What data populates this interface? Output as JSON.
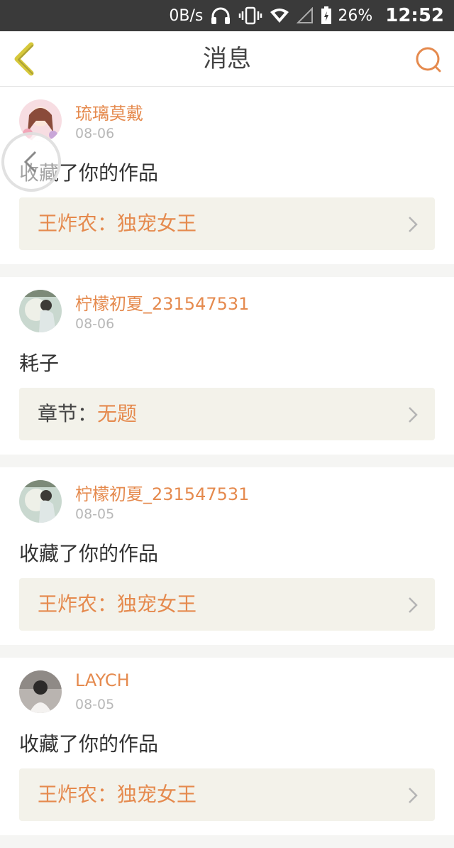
{
  "status_bar": {
    "speed": "0B/s",
    "battery_pct": "26%",
    "time": "12:52",
    "icons": [
      "headphones-icon",
      "vibrate-icon",
      "wifi-icon",
      "signal-icon",
      "battery-icon"
    ]
  },
  "header": {
    "title": "消息",
    "back_icon": "chevron-left-icon",
    "search_icon": "search-icon",
    "accent": "#e58a4e",
    "back_color": "#d6c83a"
  },
  "messages": [
    {
      "username": "琉璃莫戴",
      "date": "08-06",
      "text": "收藏了你的作品",
      "ref_prefix": "",
      "ref_title": "王炸农：独宠女王"
    },
    {
      "username": "柠檬初夏_231547531",
      "date": "08-06",
      "text": "耗子",
      "ref_prefix": "章节：",
      "ref_title": "无题"
    },
    {
      "username": "柠檬初夏_231547531",
      "date": "08-05",
      "text": "收藏了你的作品",
      "ref_prefix": "",
      "ref_title": "王炸农：独宠女王"
    },
    {
      "username": "LAYCH",
      "date": "08-05",
      "text": "收藏了你的作品",
      "ref_prefix": "",
      "ref_title": "王炸农：独宠女王"
    }
  ]
}
